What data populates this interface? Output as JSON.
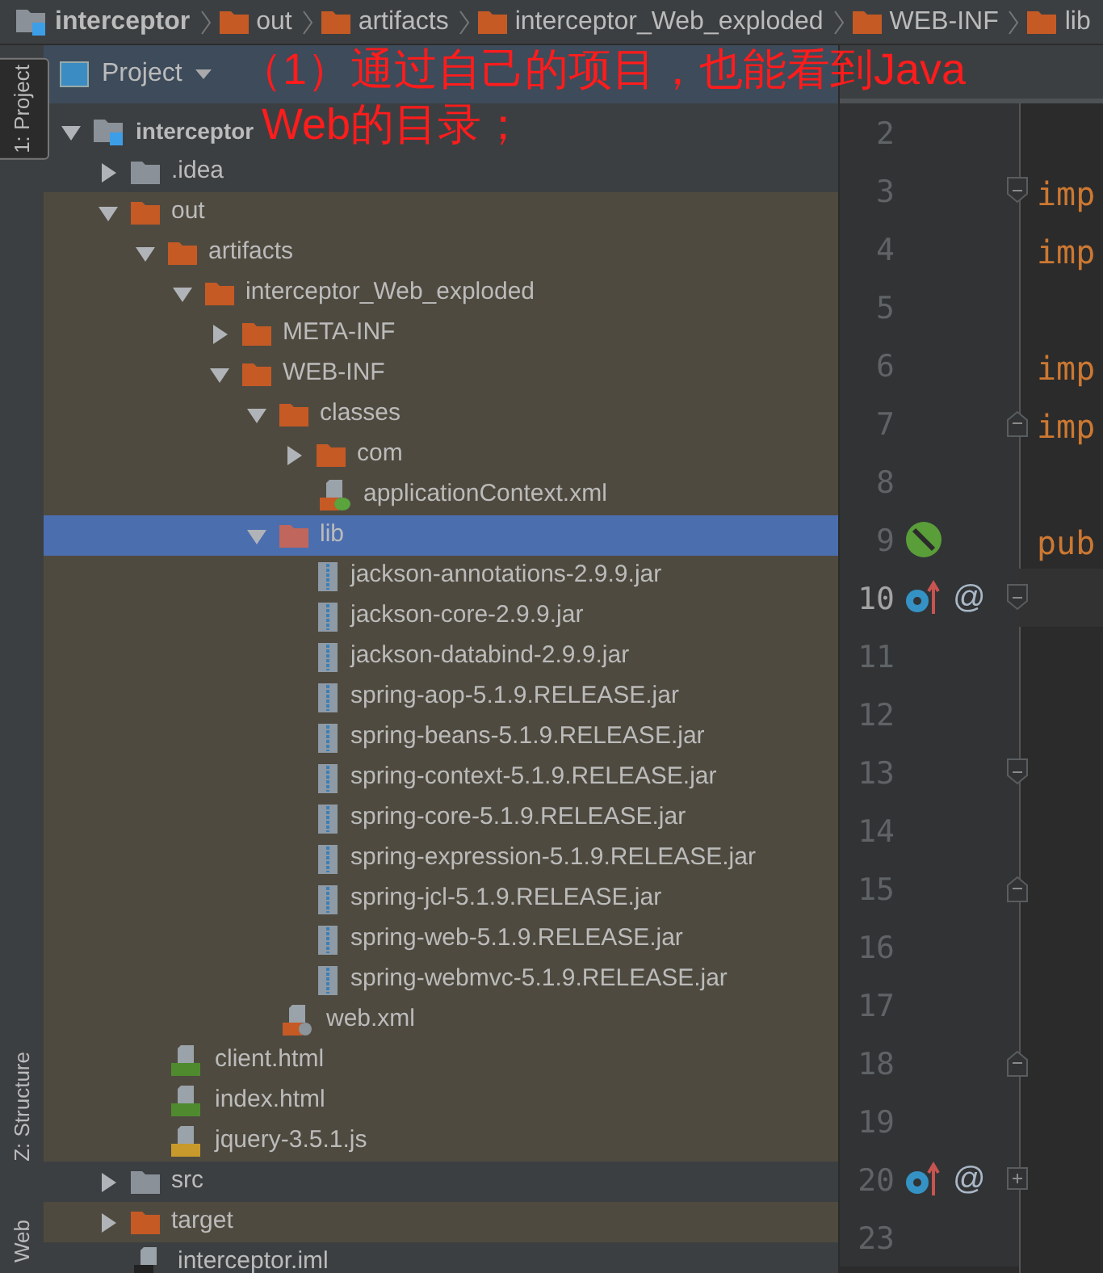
{
  "breadcrumbs": [
    {
      "label": "interceptor",
      "kind": "module"
    },
    {
      "label": "out",
      "kind": "folder"
    },
    {
      "label": "artifacts",
      "kind": "folder"
    },
    {
      "label": "interceptor_Web_exploded",
      "kind": "folder"
    },
    {
      "label": "WEB-INF",
      "kind": "folder"
    },
    {
      "label": "lib",
      "kind": "folder"
    }
  ],
  "tool_strip": [
    {
      "label": "1: Project",
      "selected": true
    },
    {
      "label": "Z: Structure",
      "selected": false
    },
    {
      "label": "Web",
      "selected": false
    }
  ],
  "project_panel": {
    "title": "Project"
  },
  "annotation": [
    "（1）通过自己的项目，也能看到Java",
    "Web的目录；"
  ],
  "tree": [
    {
      "label": "interceptor",
      "kind": "module",
      "expanded": true,
      "selected": false,
      "children": [
        {
          "label": ".idea",
          "kind": "folder",
          "excluded": false,
          "expanded": false,
          "selected": false
        },
        {
          "label": "out",
          "kind": "folder",
          "excluded": true,
          "expanded": true,
          "selected": false,
          "children": [
            {
              "label": "artifacts",
              "kind": "folder",
              "excluded": true,
              "expanded": true,
              "selected": false,
              "children": [
                {
                  "label": "interceptor_Web_exploded",
                  "kind": "folder",
                  "excluded": true,
                  "expanded": true,
                  "selected": false,
                  "children": [
                    {
                      "label": "META-INF",
                      "kind": "folder",
                      "excluded": true,
                      "expanded": false,
                      "selected": false
                    },
                    {
                      "label": "WEB-INF",
                      "kind": "folder",
                      "excluded": true,
                      "expanded": true,
                      "selected": false,
                      "children": [
                        {
                          "label": "classes",
                          "kind": "folder",
                          "excluded": true,
                          "expanded": true,
                          "selected": false,
                          "children": [
                            {
                              "label": "com",
                              "kind": "folder",
                              "excluded": true,
                              "expanded": false,
                              "selected": false
                            },
                            {
                              "label": "applicationContext.xml",
                              "kind": "spring-xml",
                              "selected": false
                            }
                          ]
                        },
                        {
                          "label": "lib",
                          "kind": "folder",
                          "excluded": true,
                          "expanded": true,
                          "selected": true,
                          "children": [
                            {
                              "label": "jackson-annotations-2.9.9.jar",
                              "kind": "jar",
                              "selected": false
                            },
                            {
                              "label": "jackson-core-2.9.9.jar",
                              "kind": "jar",
                              "selected": false
                            },
                            {
                              "label": "jackson-databind-2.9.9.jar",
                              "kind": "jar",
                              "selected": false
                            },
                            {
                              "label": "spring-aop-5.1.9.RELEASE.jar",
                              "kind": "jar",
                              "selected": false
                            },
                            {
                              "label": "spring-beans-5.1.9.RELEASE.jar",
                              "kind": "jar",
                              "selected": false
                            },
                            {
                              "label": "spring-context-5.1.9.RELEASE.jar",
                              "kind": "jar",
                              "selected": false
                            },
                            {
                              "label": "spring-core-5.1.9.RELEASE.jar",
                              "kind": "jar",
                              "selected": false
                            },
                            {
                              "label": "spring-expression-5.1.9.RELEASE.jar",
                              "kind": "jar",
                              "selected": false
                            },
                            {
                              "label": "spring-jcl-5.1.9.RELEASE.jar",
                              "kind": "jar",
                              "selected": false
                            },
                            {
                              "label": "spring-web-5.1.9.RELEASE.jar",
                              "kind": "jar",
                              "selected": false
                            },
                            {
                              "label": "spring-webmvc-5.1.9.RELEASE.jar",
                              "kind": "jar",
                              "selected": false
                            }
                          ]
                        },
                        {
                          "label": "web.xml",
                          "kind": "web-xml",
                          "selected": false
                        }
                      ]
                    }
                  ]
                }
              ]
            },
            {
              "label": "client.html",
              "kind": "html",
              "selected": false
            },
            {
              "label": "index.html",
              "kind": "html",
              "selected": false
            },
            {
              "label": "jquery-3.5.1.js",
              "kind": "js",
              "selected": false
            }
          ]
        },
        {
          "label": "src",
          "kind": "folder",
          "excluded": false,
          "expanded": false,
          "selected": false
        },
        {
          "label": "target",
          "kind": "folder",
          "excluded": true,
          "expanded": false,
          "selected": false
        },
        {
          "label": "interceptor.iml",
          "kind": "iml",
          "selected": false
        }
      ]
    }
  ],
  "editor": {
    "lines": [
      {
        "number": "2",
        "current": false
      },
      {
        "number": "3",
        "code": "imp",
        "fold": {
          "kind": "start"
        },
        "current": false
      },
      {
        "number": "4",
        "code": "imp",
        "current": false
      },
      {
        "number": "5",
        "current": false
      },
      {
        "number": "6",
        "code": "imp",
        "current": false
      },
      {
        "number": "7",
        "code": "imp",
        "fold": {
          "kind": "end"
        },
        "current": false
      },
      {
        "number": "8",
        "current": false
      },
      {
        "number": "9",
        "code": "pub",
        "gutter": {
          "kind": "bean"
        },
        "current": false
      },
      {
        "number": "10",
        "fold": {
          "kind": "start"
        },
        "gutter": {
          "kind": "override"
        },
        "marker": "@",
        "current": true
      },
      {
        "number": "11",
        "current": false
      },
      {
        "number": "12",
        "current": false
      },
      {
        "number": "13",
        "fold": {
          "kind": "start"
        },
        "current": false
      },
      {
        "number": "14",
        "current": false
      },
      {
        "number": "15",
        "fold": {
          "kind": "end"
        },
        "current": false
      },
      {
        "number": "16",
        "current": false
      },
      {
        "number": "17",
        "current": false
      },
      {
        "number": "18",
        "fold": {
          "kind": "end"
        },
        "current": false
      },
      {
        "number": "19",
        "current": false
      },
      {
        "number": "20",
        "fold": {
          "kind": "collapsed"
        },
        "gutter": {
          "kind": "override"
        },
        "marker": "@",
        "current": false
      },
      {
        "number": "23",
        "current": false
      }
    ]
  }
}
